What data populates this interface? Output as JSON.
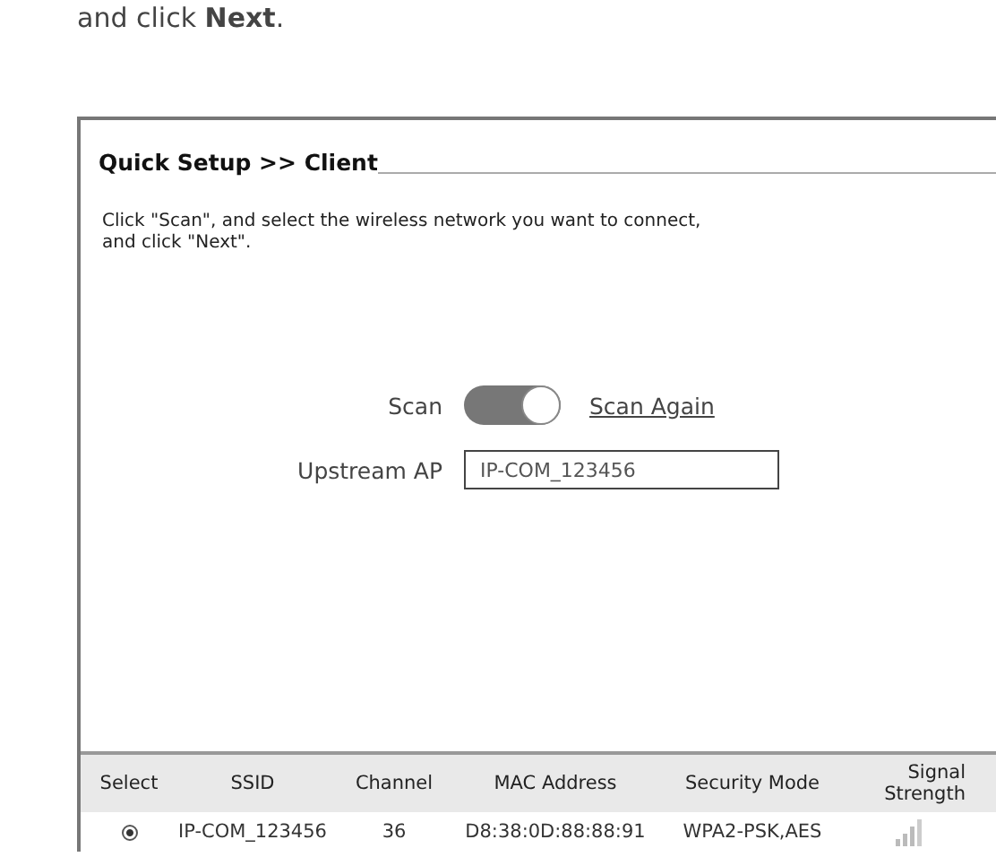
{
  "doc_text": "and click **Next**.",
  "panel": {
    "title": "Quick Setup >> Client",
    "instruction": "Click \"Scan\", and select the wireless network you want to connect,\nand click \"Next\".",
    "scan": {
      "label": "Scan",
      "on": true,
      "link": "Scan Again"
    },
    "upstream_ap": {
      "label": "Upstream AP",
      "value": "IP-COM_123456"
    }
  },
  "table": {
    "columns": [
      "Select",
      "SSID",
      "Channel",
      "MAC Address",
      "Security Mode",
      "Signal Strength"
    ],
    "rows": [
      {
        "selected": true,
        "ssid": "IP-COM_123456",
        "channel": "36",
        "mac": "D8:38:0D:88:88:91",
        "security": "WPA2-PSK,AES"
      }
    ]
  }
}
